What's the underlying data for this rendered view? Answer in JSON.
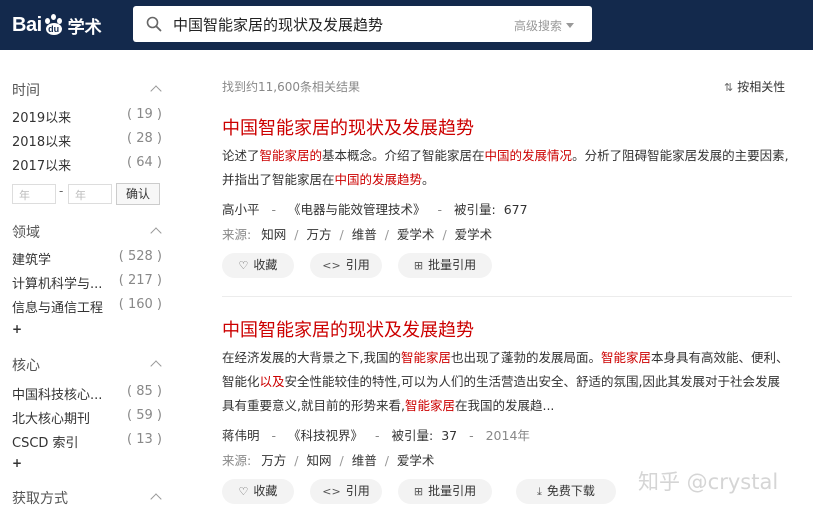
{
  "header": {
    "logo_bai": "Bai",
    "logo_du": "du",
    "logo_xueshu": "学术",
    "search_query": "中国智能家居的现状及发展趋势",
    "advanced_search": "高级搜索"
  },
  "sidebar": {
    "time": {
      "title": "时间",
      "items": [
        {
          "label": "2019以来",
          "count": "( 19 )"
        },
        {
          "label": "2018以来",
          "count": "( 28 )"
        },
        {
          "label": "2017以来",
          "count": "( 64 )"
        }
      ],
      "from_placeholder": "年",
      "to_placeholder": "年",
      "dash": "-",
      "confirm": "确认"
    },
    "field": {
      "title": "领域",
      "items": [
        {
          "label": "建筑学",
          "count": "( 528 )"
        },
        {
          "label": "计算机科学与...",
          "count": "( 217 )"
        },
        {
          "label": "信息与通信工程",
          "count": "( 160 )"
        }
      ],
      "more": "+"
    },
    "core": {
      "title": "核心",
      "items": [
        {
          "label": "中国科技核心...",
          "count": "( 85 )"
        },
        {
          "label": "北大核心期刊",
          "count": "( 59 )"
        },
        {
          "label": "CSCD 索引",
          "count": "( 13 )"
        }
      ],
      "more": "+"
    },
    "access": {
      "title": "获取方式"
    }
  },
  "results_summary": "找到约11,600条相关结果",
  "sort_label": "按相关性",
  "results": [
    {
      "title": "中国智能家居的现状及发展趋势",
      "abstract": [
        {
          "t": "论述了",
          "h": false
        },
        {
          "t": "智能家居的",
          "h": true
        },
        {
          "t": "基本概念。介绍了智能家居在",
          "h": false
        },
        {
          "t": "中国的发展情况",
          "h": true
        },
        {
          "t": "。分析了阻碍智能家居发展的主要因素,并指出了智能家居在",
          "h": false
        },
        {
          "t": "中国的发展趋势",
          "h": true
        },
        {
          "t": "。",
          "h": false
        }
      ],
      "author": "高小平",
      "journal": "《电器与能效管理技术》",
      "cited_label": "被引量:",
      "cited": "677",
      "year": "",
      "source_label": "来源:",
      "sources": [
        "知网",
        "万方",
        "维普",
        "爱学术",
        "爱学术"
      ],
      "buttons": [
        "收藏",
        "引用",
        "批量引用"
      ]
    },
    {
      "title": "中国智能家居的现状及发展趋势",
      "abstract": [
        {
          "t": "在经济发展的大背景之下,我国的",
          "h": false
        },
        {
          "t": "智能家居",
          "h": true
        },
        {
          "t": "也出现了蓬勃的发展局面。",
          "h": false
        },
        {
          "t": "智能家居",
          "h": true
        },
        {
          "t": "本身具有高效能、便利、智能化",
          "h": false
        },
        {
          "t": "以及",
          "h": true
        },
        {
          "t": "安全性能较佳的特性,可以为人们的生活营造出安全、舒适的氛围,因此其发展对于社会发展具有重要意义,就目前的形势来看,",
          "h": false
        },
        {
          "t": "智能家居",
          "h": true
        },
        {
          "t": "在我国的发展趋...",
          "h": false
        }
      ],
      "author": "蒋伟明",
      "journal": "《科技视界》",
      "cited_label": "被引量:",
      "cited": "37",
      "year": "2014年",
      "source_label": "来源:",
      "sources": [
        "万方",
        "知网",
        "维普",
        "爱学术"
      ],
      "buttons": [
        "收藏",
        "引用",
        "批量引用",
        "免费下载"
      ]
    }
  ],
  "watermark": "知乎 @crystal"
}
